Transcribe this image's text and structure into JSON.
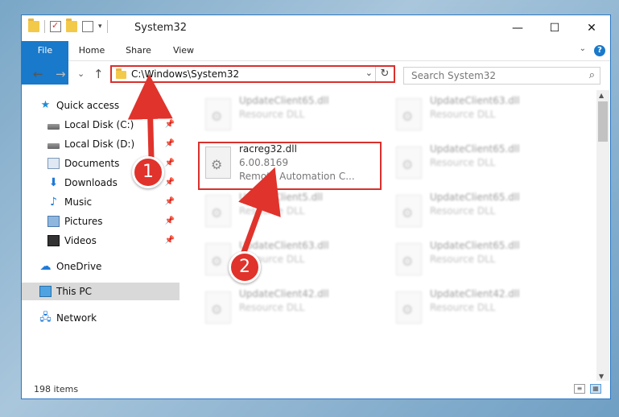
{
  "window": {
    "title": "System32",
    "minimize": "—",
    "maximize": "☐",
    "close": "✕"
  },
  "ribbon": {
    "tabs": [
      "File",
      "Home",
      "Share",
      "View"
    ],
    "help": "?"
  },
  "nav": {
    "back": "←",
    "forward": "→",
    "recent": "⌄",
    "up": "↑"
  },
  "address": {
    "path": "C:\\Windows\\System32",
    "dropdown": "⌄",
    "refresh": "↻"
  },
  "search": {
    "placeholder": "Search System32",
    "icon": "search-icon"
  },
  "sidebar": {
    "items": [
      {
        "label": "Quick access",
        "icon": "star-icon"
      },
      {
        "label": "Local Disk (C:)",
        "icon": "disk-icon"
      },
      {
        "label": "Local Disk (D:)",
        "icon": "disk-icon"
      },
      {
        "label": "Documents",
        "icon": "documents-icon"
      },
      {
        "label": "Downloads",
        "icon": "download-icon"
      },
      {
        "label": "Music",
        "icon": "music-icon"
      },
      {
        "label": "Pictures",
        "icon": "pictures-icon"
      },
      {
        "label": "Videos",
        "icon": "videos-icon"
      },
      {
        "label": "OneDrive",
        "icon": "cloud-icon"
      },
      {
        "label": "This PC",
        "icon": "computer-icon"
      },
      {
        "label": "Network",
        "icon": "network-icon"
      }
    ]
  },
  "files": {
    "left": [
      {
        "name": "UpdateClient65.dll",
        "line2": "Resource DLL",
        "line3": ""
      },
      {
        "name": "racreg32.dll",
        "line2": "6.00.8169",
        "line3": "Remote Automation C..."
      },
      {
        "name": "UpdateClient5.dll",
        "line2": "Resource DLL",
        "line3": ""
      },
      {
        "name": "UpdateClient63.dll",
        "line2": "Resource DLL",
        "line3": ""
      },
      {
        "name": "UpdateClient42.dll",
        "line2": "Resource DLL",
        "line3": ""
      }
    ],
    "right": [
      {
        "name": "UpdateClient63.dll",
        "line2": "Resource DLL"
      },
      {
        "name": "UpdateClient65.dll",
        "line2": "Resource DLL"
      },
      {
        "name": "UpdateClient65.dll",
        "line2": "Resource DLL"
      },
      {
        "name": "UpdateClient65.dll",
        "line2": "Resource DLL"
      },
      {
        "name": "UpdateClient42.dll",
        "line2": "Resource DLL"
      }
    ]
  },
  "status": {
    "count": "198 items"
  },
  "annotations": {
    "badge1": "1",
    "badge2": "2"
  },
  "colors": {
    "accent": "#1979ca",
    "highlight": "#d9302c"
  }
}
